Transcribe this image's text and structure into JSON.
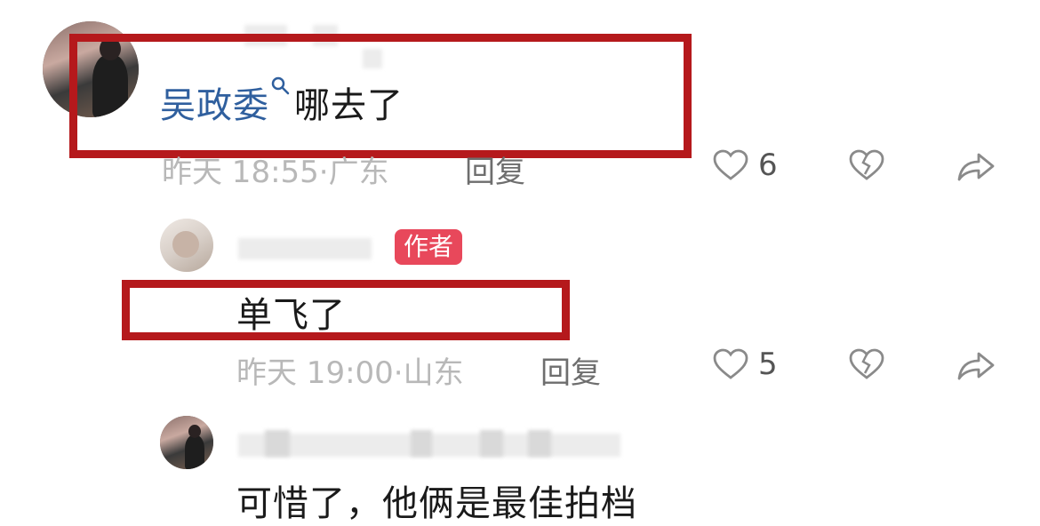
{
  "comments": [
    {
      "username": "吴政委",
      "text": "哪去了",
      "time": "昨天 18:55·",
      "location": "广东",
      "reply_label": "回复",
      "likes": "6"
    },
    {
      "author_badge": "作者",
      "text": "单飞了",
      "time": "昨天 19:00·",
      "location": "山东",
      "reply_label": "回复",
      "likes": "5"
    },
    {
      "text": "可惜了，他俩是最佳拍档"
    }
  ],
  "colors": {
    "highlight_box": "#b5191c",
    "username_link": "#2f5f9e",
    "author_badge": "#e8485b"
  },
  "icons": [
    "search-icon",
    "heart-icon",
    "broken-heart-icon",
    "share-arrow-icon"
  ]
}
